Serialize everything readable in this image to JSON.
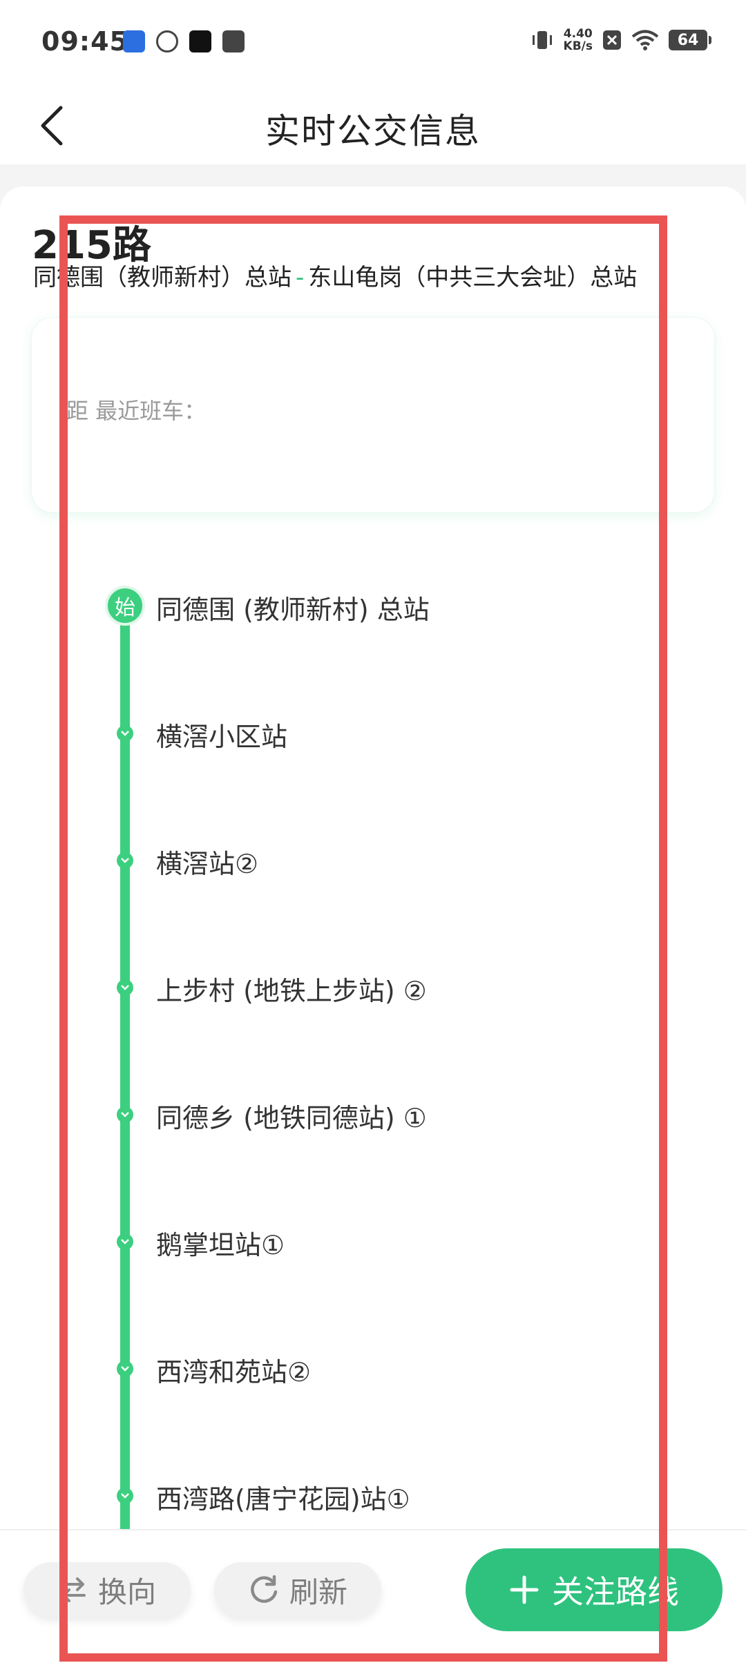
{
  "status_bar": {
    "time": "09:45",
    "net_speed_value": "4.40",
    "net_speed_unit": "KB/s",
    "battery": "64"
  },
  "header": {
    "title": "实时公交信息"
  },
  "route": {
    "number": "215路",
    "origin": "同德围（教师新村）总站",
    "separator": "-",
    "destination": "东山龟岗（中共三大会址）总站"
  },
  "next_bus": {
    "label": "距 最近班车："
  },
  "stops": {
    "start_badge": "始",
    "items": [
      {
        "name": "同德围 (教师新村) 总站"
      },
      {
        "name": "横滘小区站"
      },
      {
        "name": "横滘站②"
      },
      {
        "name": "上步村 (地铁上步站) ②"
      },
      {
        "name": "同德乡 (地铁同德站) ①"
      },
      {
        "name": "鹅掌坦站①"
      },
      {
        "name": "西湾和苑站②"
      },
      {
        "name": "西湾路(唐宁花园)站①"
      }
    ]
  },
  "bottom_bar": {
    "reverse_label": "换向",
    "refresh_label": "刷新",
    "follow_label": "关注路线"
  },
  "colors": {
    "accent_green": "#2ec27e",
    "line_green": "#3ccf7f",
    "highlight_red": "#ea5554"
  }
}
